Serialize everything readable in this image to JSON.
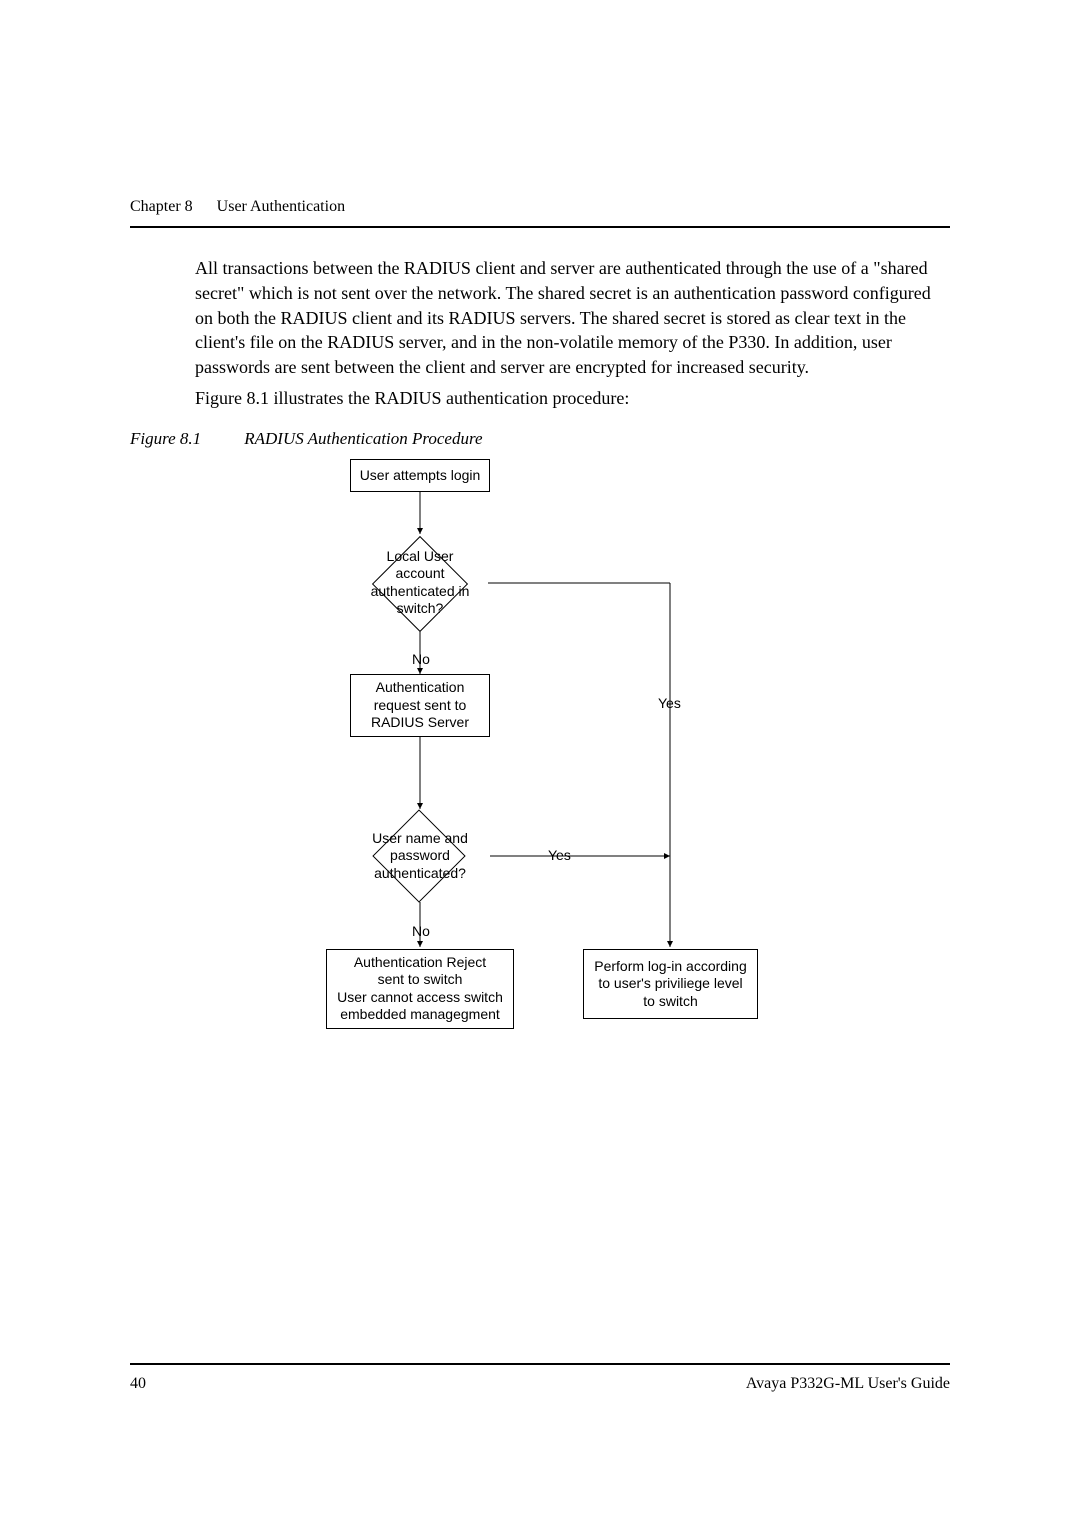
{
  "header": {
    "chapter": "Chapter 8",
    "title": "User Authentication"
  },
  "paragraph1": "All transactions between the RADIUS client and server are authenticated through the use of a \"shared secret\" which is not sent over the network. The shared secret is an authentication password configured on both the RADIUS client and its RADIUS servers. The shared secret is stored as clear text in the client's file on the RADIUS server, and in the non-volatile memory of the P330. In addition, user passwords are sent between the client and server are encrypted for increased security.",
  "paragraph2": "Figure 8.1 illustrates the RADIUS authentication procedure:",
  "figure": {
    "number": "Figure 8.1",
    "caption": "RADIUS Authentication Procedure"
  },
  "flow": {
    "box_login": "User attempts login",
    "diamond_local_l1": "Local User",
    "diamond_local_l2": "account",
    "diamond_local_l3": "authenticated in",
    "diamond_local_l4": "switch?",
    "no_label1": "No",
    "box_request_l1": "Authentication",
    "box_request_l2": "request sent to",
    "box_request_l3": "RADIUS Server",
    "yes_label1": "Yes",
    "diamond_auth_l1": "User name and",
    "diamond_auth_l2": "password",
    "diamond_auth_l3": "authenticated?",
    "yes_label2": "Yes",
    "no_label2": "No",
    "box_reject_l1": "Authentication Reject",
    "box_reject_l2": "sent to switch",
    "box_reject_l3": "User cannot access switch",
    "box_reject_l4": "embedded managegment",
    "box_perform_l1": "Perform log-in according",
    "box_perform_l2": "to user's priviliege level",
    "box_perform_l3": "to switch"
  },
  "footer": {
    "page": "40",
    "guide": "Avaya P332G-ML User's Guide"
  }
}
